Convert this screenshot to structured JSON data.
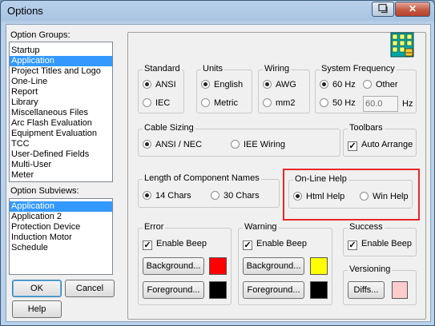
{
  "window": {
    "title": "Options"
  },
  "colors": {
    "error_bg": "#ff0000",
    "error_fg": "#000000",
    "warning_bg": "#ffff00",
    "warning_fg": "#000000",
    "diffs_swatch": "#ffcccc",
    "highlight": "#e8282b",
    "selection": "#3399ff"
  },
  "option_groups": {
    "label": "Option Groups:",
    "items": [
      "Startup",
      "Application",
      "Project Titles and Logo",
      "One-Line",
      "Report",
      "Library",
      "Miscellaneous Files",
      "Arc Flash Evaluation",
      "Equipment Evaluation",
      "TCC",
      "User-Defined Fields",
      "Multi-User",
      "Meter"
    ],
    "selected_index": 1
  },
  "option_subviews": {
    "label": "Option Subviews:",
    "items": [
      "Application",
      "Application 2",
      "Protection Device",
      "Induction Motor",
      "Schedule"
    ],
    "selected_index": 0
  },
  "buttons": {
    "ok": "OK",
    "cancel": "Cancel",
    "help": "Help"
  },
  "standard": {
    "caption": "Standard",
    "options": [
      "ANSI",
      "IEC"
    ],
    "selected": "ANSI"
  },
  "units": {
    "caption": "Units",
    "options": [
      "English",
      "Metric"
    ],
    "selected": "English"
  },
  "wiring": {
    "caption": "Wiring",
    "options": [
      "AWG",
      "mm2"
    ],
    "selected": "AWG"
  },
  "system_frequency": {
    "caption": "System Frequency",
    "options": [
      "60 Hz",
      "Other",
      "50 Hz"
    ],
    "selected": "60 Hz",
    "other_value": "60.0",
    "unit": "Hz"
  },
  "cable_sizing": {
    "caption": "Cable Sizing",
    "options": [
      "ANSI / NEC",
      "IEE Wiring"
    ],
    "selected": "ANSI / NEC"
  },
  "toolbars": {
    "caption": "Toolbars",
    "auto_arrange": "Auto Arrange",
    "checked": true
  },
  "component_names": {
    "caption": "Length of Component Names",
    "options": [
      "14 Chars",
      "30 Chars"
    ],
    "selected": "14 Chars"
  },
  "online_help": {
    "caption": "On-Line Help",
    "options": [
      "Html Help",
      "Win Help"
    ],
    "selected": "Html Help"
  },
  "error": {
    "caption": "Error",
    "enable_beep": "Enable Beep",
    "checked": true,
    "background": "Background...",
    "foreground": "Foreground..."
  },
  "warning": {
    "caption": "Warning",
    "enable_beep": "Enable Beep",
    "checked": true,
    "background": "Background...",
    "foreground": "Foreground..."
  },
  "success": {
    "caption": "Success",
    "enable_beep": "Enable Beep",
    "checked": true
  },
  "versioning": {
    "caption": "Versioning",
    "diffs": "Diffs..."
  },
  "icons": {
    "help": "context-help-icon",
    "close": "close-icon",
    "app": "building-icon"
  }
}
